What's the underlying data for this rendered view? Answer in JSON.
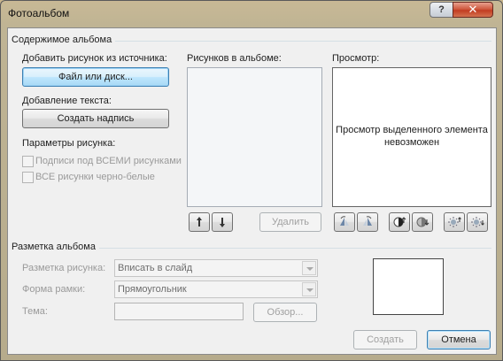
{
  "window": {
    "title": "Фотоальбом",
    "help_label": "?",
    "close_label": "✕"
  },
  "content_group": {
    "title": "Содержимое альбома",
    "add_picture_label": "Добавить рисунок из источника:",
    "file_disk_button": "Файл или диск...",
    "add_text_label": "Добавление текста:",
    "create_caption_button": "Создать надпись",
    "picture_options_label": "Параметры рисунка:",
    "captions_checkbox": "Подписи под ВСЕМИ рисунками",
    "bw_checkbox": "ВСЕ рисунки черно-белые",
    "pictures_in_album_label": "Рисунков в альбоме:",
    "delete_button": "Удалить",
    "preview_label": "Просмотр:",
    "preview_message": "Просмотр выделенного элемента невозможен"
  },
  "layout_group": {
    "title": "Разметка альбома",
    "picture_layout_label": "Разметка рисунка:",
    "picture_layout_value": "Вписать в слайд",
    "frame_shape_label": "Форма рамки:",
    "frame_shape_value": "Прямоугольник",
    "theme_label": "Тема:",
    "theme_value": "",
    "browse_button": "Обзор..."
  },
  "footer": {
    "create_button": "Создать",
    "cancel_button": "Отмена"
  },
  "icons": [
    "move-up-icon",
    "move-down-icon",
    "rotate-left-icon",
    "rotate-right-icon",
    "contrast-increase-icon",
    "contrast-decrease-icon",
    "brightness-increase-icon",
    "brightness-decrease-icon"
  ]
}
